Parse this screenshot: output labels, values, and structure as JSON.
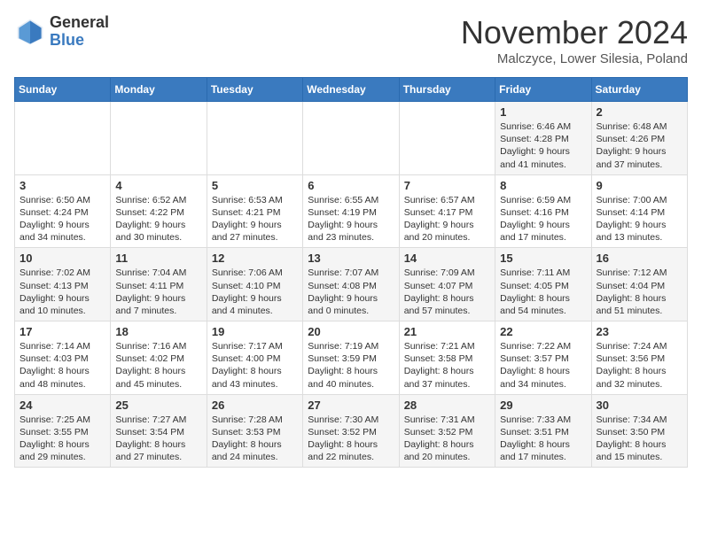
{
  "header": {
    "logo_general": "General",
    "logo_blue": "Blue",
    "month_title": "November 2024",
    "subtitle": "Malczyce, Lower Silesia, Poland"
  },
  "weekdays": [
    "Sunday",
    "Monday",
    "Tuesday",
    "Wednesday",
    "Thursday",
    "Friday",
    "Saturday"
  ],
  "weeks": [
    [
      {
        "day": "",
        "info": ""
      },
      {
        "day": "",
        "info": ""
      },
      {
        "day": "",
        "info": ""
      },
      {
        "day": "",
        "info": ""
      },
      {
        "day": "",
        "info": ""
      },
      {
        "day": "1",
        "info": "Sunrise: 6:46 AM\nSunset: 4:28 PM\nDaylight: 9 hours and 41 minutes."
      },
      {
        "day": "2",
        "info": "Sunrise: 6:48 AM\nSunset: 4:26 PM\nDaylight: 9 hours and 37 minutes."
      }
    ],
    [
      {
        "day": "3",
        "info": "Sunrise: 6:50 AM\nSunset: 4:24 PM\nDaylight: 9 hours and 34 minutes."
      },
      {
        "day": "4",
        "info": "Sunrise: 6:52 AM\nSunset: 4:22 PM\nDaylight: 9 hours and 30 minutes."
      },
      {
        "day": "5",
        "info": "Sunrise: 6:53 AM\nSunset: 4:21 PM\nDaylight: 9 hours and 27 minutes."
      },
      {
        "day": "6",
        "info": "Sunrise: 6:55 AM\nSunset: 4:19 PM\nDaylight: 9 hours and 23 minutes."
      },
      {
        "day": "7",
        "info": "Sunrise: 6:57 AM\nSunset: 4:17 PM\nDaylight: 9 hours and 20 minutes."
      },
      {
        "day": "8",
        "info": "Sunrise: 6:59 AM\nSunset: 4:16 PM\nDaylight: 9 hours and 17 minutes."
      },
      {
        "day": "9",
        "info": "Sunrise: 7:00 AM\nSunset: 4:14 PM\nDaylight: 9 hours and 13 minutes."
      }
    ],
    [
      {
        "day": "10",
        "info": "Sunrise: 7:02 AM\nSunset: 4:13 PM\nDaylight: 9 hours and 10 minutes."
      },
      {
        "day": "11",
        "info": "Sunrise: 7:04 AM\nSunset: 4:11 PM\nDaylight: 9 hours and 7 minutes."
      },
      {
        "day": "12",
        "info": "Sunrise: 7:06 AM\nSunset: 4:10 PM\nDaylight: 9 hours and 4 minutes."
      },
      {
        "day": "13",
        "info": "Sunrise: 7:07 AM\nSunset: 4:08 PM\nDaylight: 9 hours and 0 minutes."
      },
      {
        "day": "14",
        "info": "Sunrise: 7:09 AM\nSunset: 4:07 PM\nDaylight: 8 hours and 57 minutes."
      },
      {
        "day": "15",
        "info": "Sunrise: 7:11 AM\nSunset: 4:05 PM\nDaylight: 8 hours and 54 minutes."
      },
      {
        "day": "16",
        "info": "Sunrise: 7:12 AM\nSunset: 4:04 PM\nDaylight: 8 hours and 51 minutes."
      }
    ],
    [
      {
        "day": "17",
        "info": "Sunrise: 7:14 AM\nSunset: 4:03 PM\nDaylight: 8 hours and 48 minutes."
      },
      {
        "day": "18",
        "info": "Sunrise: 7:16 AM\nSunset: 4:02 PM\nDaylight: 8 hours and 45 minutes."
      },
      {
        "day": "19",
        "info": "Sunrise: 7:17 AM\nSunset: 4:00 PM\nDaylight: 8 hours and 43 minutes."
      },
      {
        "day": "20",
        "info": "Sunrise: 7:19 AM\nSunset: 3:59 PM\nDaylight: 8 hours and 40 minutes."
      },
      {
        "day": "21",
        "info": "Sunrise: 7:21 AM\nSunset: 3:58 PM\nDaylight: 8 hours and 37 minutes."
      },
      {
        "day": "22",
        "info": "Sunrise: 7:22 AM\nSunset: 3:57 PM\nDaylight: 8 hours and 34 minutes."
      },
      {
        "day": "23",
        "info": "Sunrise: 7:24 AM\nSunset: 3:56 PM\nDaylight: 8 hours and 32 minutes."
      }
    ],
    [
      {
        "day": "24",
        "info": "Sunrise: 7:25 AM\nSunset: 3:55 PM\nDaylight: 8 hours and 29 minutes."
      },
      {
        "day": "25",
        "info": "Sunrise: 7:27 AM\nSunset: 3:54 PM\nDaylight: 8 hours and 27 minutes."
      },
      {
        "day": "26",
        "info": "Sunrise: 7:28 AM\nSunset: 3:53 PM\nDaylight: 8 hours and 24 minutes."
      },
      {
        "day": "27",
        "info": "Sunrise: 7:30 AM\nSunset: 3:52 PM\nDaylight: 8 hours and 22 minutes."
      },
      {
        "day": "28",
        "info": "Sunrise: 7:31 AM\nSunset: 3:52 PM\nDaylight: 8 hours and 20 minutes."
      },
      {
        "day": "29",
        "info": "Sunrise: 7:33 AM\nSunset: 3:51 PM\nDaylight: 8 hours and 17 minutes."
      },
      {
        "day": "30",
        "info": "Sunrise: 7:34 AM\nSunset: 3:50 PM\nDaylight: 8 hours and 15 minutes."
      }
    ]
  ]
}
